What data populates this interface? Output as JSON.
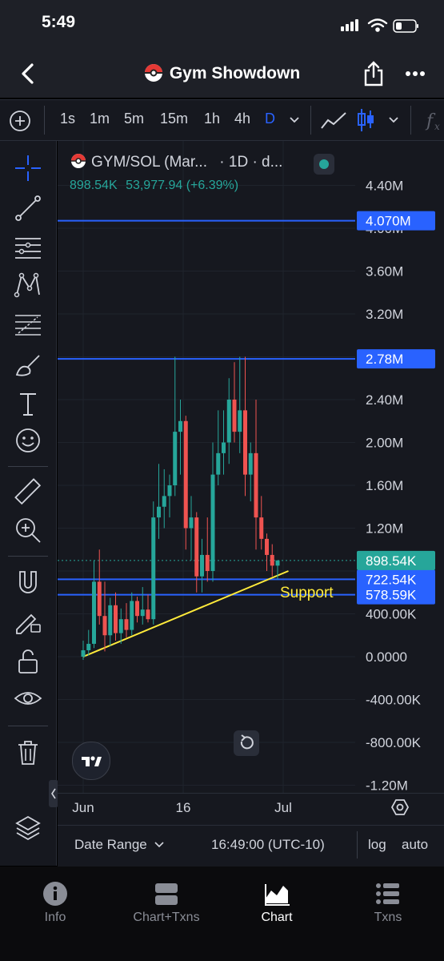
{
  "status_bar": {
    "time": "5:49"
  },
  "nav": {
    "title": "Gym Showdown"
  },
  "toolbar": {
    "timeframes": [
      "1s",
      "1m",
      "5m",
      "15m",
      "1h",
      "4h",
      "D"
    ]
  },
  "legend": {
    "symbol": "GYM/SOL (Mar...",
    "interval": "· 1D · d...",
    "price": "898.54K",
    "change": "53,977.94 (+6.39%)"
  },
  "axis": {
    "y_ticks": [
      "4.40M",
      "4.00M",
      "3.60M",
      "3.20M",
      "2.80M",
      "2.40M",
      "2.00M",
      "1.60M",
      "1.20M",
      "800.00K",
      "400.00K",
      "0.0000",
      "-400.00K",
      "-800.00K",
      "-1.20M"
    ],
    "x_ticks": [
      "Jun",
      "16",
      "Jul"
    ]
  },
  "bottom_bar": {
    "date_range": "Date Range",
    "time": "16:49:00 (UTC-10)",
    "log": "log",
    "auto": "auto"
  },
  "tabs": [
    {
      "label": "Info"
    },
    {
      "label": "Chart+Txns"
    },
    {
      "label": "Chart"
    },
    {
      "label": "Txns"
    }
  ],
  "colors": {
    "up": "#26a69a",
    "down": "#ef5350",
    "hline": "#2962ff",
    "trend": "#ffeb3b",
    "accent": "#2962ff"
  },
  "chart_data": {
    "type": "candlestick",
    "ylim": [
      -1200000,
      4600000
    ],
    "x_labels": [
      "Jun",
      "16",
      "Jul"
    ],
    "candles": [
      {
        "o": 0,
        "h": 150000,
        "l": -30000,
        "c": 60000
      },
      {
        "o": 60000,
        "h": 250000,
        "l": 10000,
        "c": 120000
      },
      {
        "o": 120000,
        "h": 900000,
        "l": 80000,
        "c": 700000
      },
      {
        "o": 700000,
        "h": 1000000,
        "l": 300000,
        "c": 380000
      },
      {
        "o": 380000,
        "h": 700000,
        "l": 50000,
        "c": 200000
      },
      {
        "o": 200000,
        "h": 550000,
        "l": 100000,
        "c": 480000
      },
      {
        "o": 480000,
        "h": 600000,
        "l": 150000,
        "c": 220000
      },
      {
        "o": 220000,
        "h": 450000,
        "l": 120000,
        "c": 350000
      },
      {
        "o": 350000,
        "h": 500000,
        "l": 180000,
        "c": 250000
      },
      {
        "o": 250000,
        "h": 600000,
        "l": 200000,
        "c": 520000
      },
      {
        "o": 520000,
        "h": 560000,
        "l": 320000,
        "c": 380000
      },
      {
        "o": 380000,
        "h": 650000,
        "l": 300000,
        "c": 440000
      },
      {
        "o": 440000,
        "h": 580000,
        "l": 320000,
        "c": 350000
      },
      {
        "o": 350000,
        "h": 1450000,
        "l": 300000,
        "c": 1300000
      },
      {
        "o": 1300000,
        "h": 1800000,
        "l": 1100000,
        "c": 1400000
      },
      {
        "o": 1400000,
        "h": 1750000,
        "l": 1200000,
        "c": 1500000
      },
      {
        "o": 1500000,
        "h": 1700000,
        "l": 1300000,
        "c": 1600000
      },
      {
        "o": 1600000,
        "h": 2800000,
        "l": 1500000,
        "c": 2100000
      },
      {
        "o": 2100000,
        "h": 2400000,
        "l": 1700000,
        "c": 2200000
      },
      {
        "o": 2200000,
        "h": 2250000,
        "l": 1000000,
        "c": 1200000
      },
      {
        "o": 1200000,
        "h": 1500000,
        "l": 900000,
        "c": 1300000
      },
      {
        "o": 1300000,
        "h": 1350000,
        "l": 600000,
        "c": 750000
      },
      {
        "o": 750000,
        "h": 1100000,
        "l": 600000,
        "c": 950000
      },
      {
        "o": 950000,
        "h": 1300000,
        "l": 700000,
        "c": 800000
      },
      {
        "o": 800000,
        "h": 2000000,
        "l": 700000,
        "c": 1700000
      },
      {
        "o": 1700000,
        "h": 2300000,
        "l": 1600000,
        "c": 1900000
      },
      {
        "o": 1900000,
        "h": 2300000,
        "l": 1700000,
        "c": 2000000
      },
      {
        "o": 2000000,
        "h": 2600000,
        "l": 1800000,
        "c": 2400000
      },
      {
        "o": 2400000,
        "h": 2750000,
        "l": 2000000,
        "c": 2100000
      },
      {
        "o": 2100000,
        "h": 2800000,
        "l": 1900000,
        "c": 2300000
      },
      {
        "o": 2300000,
        "h": 2800000,
        "l": 1500000,
        "c": 1700000
      },
      {
        "o": 1700000,
        "h": 2000000,
        "l": 1450000,
        "c": 1900000
      },
      {
        "o": 1900000,
        "h": 2400000,
        "l": 1000000,
        "c": 1300000
      },
      {
        "o": 1300000,
        "h": 1500000,
        "l": 1000000,
        "c": 1100000
      },
      {
        "o": 1100000,
        "h": 1150000,
        "l": 800000,
        "c": 950000
      },
      {
        "o": 950000,
        "h": 1050000,
        "l": 750000,
        "c": 850000
      },
      {
        "o": 850000,
        "h": 900000,
        "l": 720000,
        "c": 898540
      }
    ],
    "horizontal_lines": [
      {
        "value": 4070000,
        "label": "4.070M"
      },
      {
        "value": 2780000,
        "label": "2.78M"
      },
      {
        "value": 722540,
        "label": "722.54K"
      },
      {
        "value": 578590,
        "label": "578.59K"
      }
    ],
    "last_price": {
      "value": 898540,
      "label": "898.54K"
    },
    "trendline": {
      "label": "Support",
      "from_candle": 0,
      "from_value": 0,
      "to_candle": 38,
      "to_value": 800000
    }
  }
}
